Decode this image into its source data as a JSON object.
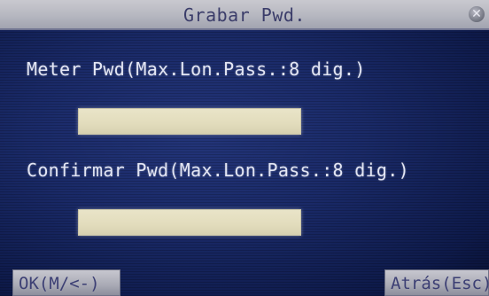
{
  "window": {
    "title": "Grabar Pwd.",
    "close_icon": "close-icon"
  },
  "form": {
    "field1_label": "Meter Pwd(Max.Lon.Pass.:8 dig.)",
    "field1_value": "",
    "field2_label": "Confirmar Pwd(Max.Lon.Pass.:8 dig.)",
    "field2_value": ""
  },
  "buttons": {
    "ok_label": "OK(M/<-)",
    "back_label": "Atrás(Esc)"
  },
  "colors": {
    "background": "#1a2a68",
    "titlebar": "#b6b7c0",
    "field": "#e2dcbc",
    "text": "#e3e6f4"
  }
}
